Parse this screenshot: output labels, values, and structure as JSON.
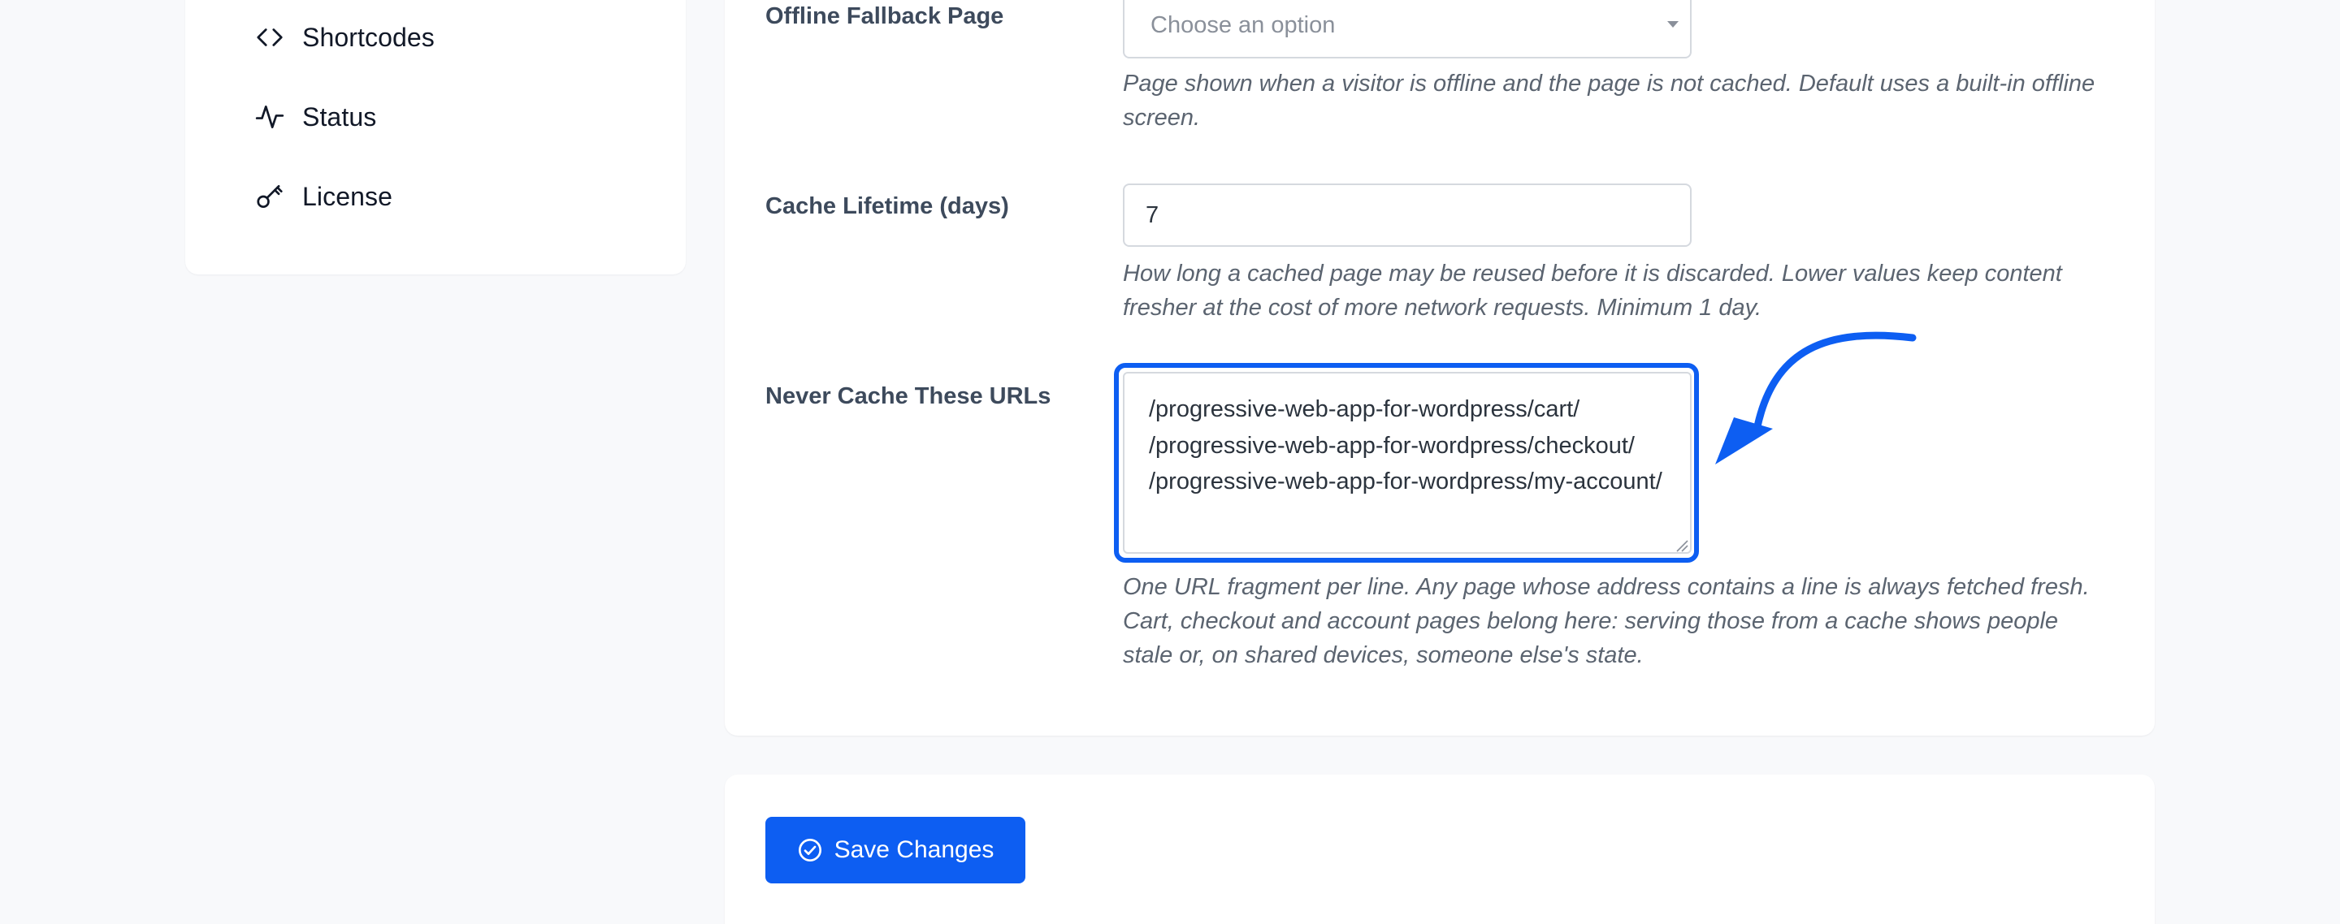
{
  "sidebar": {
    "items": [
      {
        "label": "Shortcodes",
        "icon": "code-icon"
      },
      {
        "label": "Status",
        "icon": "activity-icon"
      },
      {
        "label": "License",
        "icon": "key-icon"
      }
    ]
  },
  "settings": {
    "offline_fallback": {
      "label": "Offline Fallback Page",
      "placeholder": "Choose an option",
      "description": "Page shown when a visitor is offline and the page is not cached. Default uses a built-in offline screen."
    },
    "cache_lifetime": {
      "label": "Cache Lifetime (days)",
      "value": "7",
      "description": "How long a cached page may be reused before it is discarded. Lower values keep content fresher at the cost of more network requests. Minimum 1 day."
    },
    "never_cache": {
      "label": "Never Cache These URLs",
      "value": "/progressive-web-app-for-wordpress/cart/\n/progressive-web-app-for-wordpress/checkout/\n/progressive-web-app-for-wordpress/my-account/",
      "description": "One URL fragment per line. Any page whose address contains a line is always fetched fresh. Cart, checkout and account pages belong here: serving those from a cache shows people stale or, on shared devices, someone else's state."
    }
  },
  "save": {
    "label": "Save Changes",
    "icon": "check-circle-icon"
  },
  "colors": {
    "accent": "#0d5ef2",
    "annotation_arrow": "#0d5ef2"
  }
}
